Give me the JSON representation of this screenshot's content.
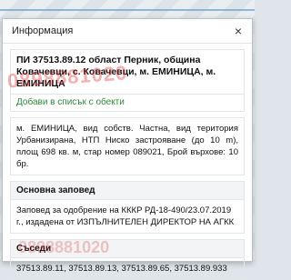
{
  "watermark": {
    "text1": "0898881020",
    "text2": "0898881020"
  },
  "dialog": {
    "title": "Информация",
    "close_label": "×",
    "property_heading": "ПИ 37513.89.12 област Перник, община Ковачевци, с. Ковачевци, м. ЕМИНИЦА, м. ЕМИНИЦА",
    "add_to_list_label": "Добави в списък с обекти",
    "description": "м. ЕМИНИЦА, вид собств. Частна, вид територия Урбанизирана, НТП Ниско застрояване (до 10 m), площ 698 кв. м, стар номер 089021, Брой върхове: 10 бр.",
    "order_section": {
      "title": "Основна заповед",
      "text": "Заповед за одобрение на КККР РД-18-490/23.07.2019 г., издадена от ИЗПЪЛНИТЕЛЕН ДИРЕКТОР НА АГКК"
    },
    "neighbors_section": {
      "title": "Съседи",
      "text": "37513.89.11, 37513.89.13, 37513.89.65, 37513.89.933"
    }
  },
  "colors": {
    "link_green": "#2e8b3a",
    "watermark_red": "#dc1e1e"
  }
}
